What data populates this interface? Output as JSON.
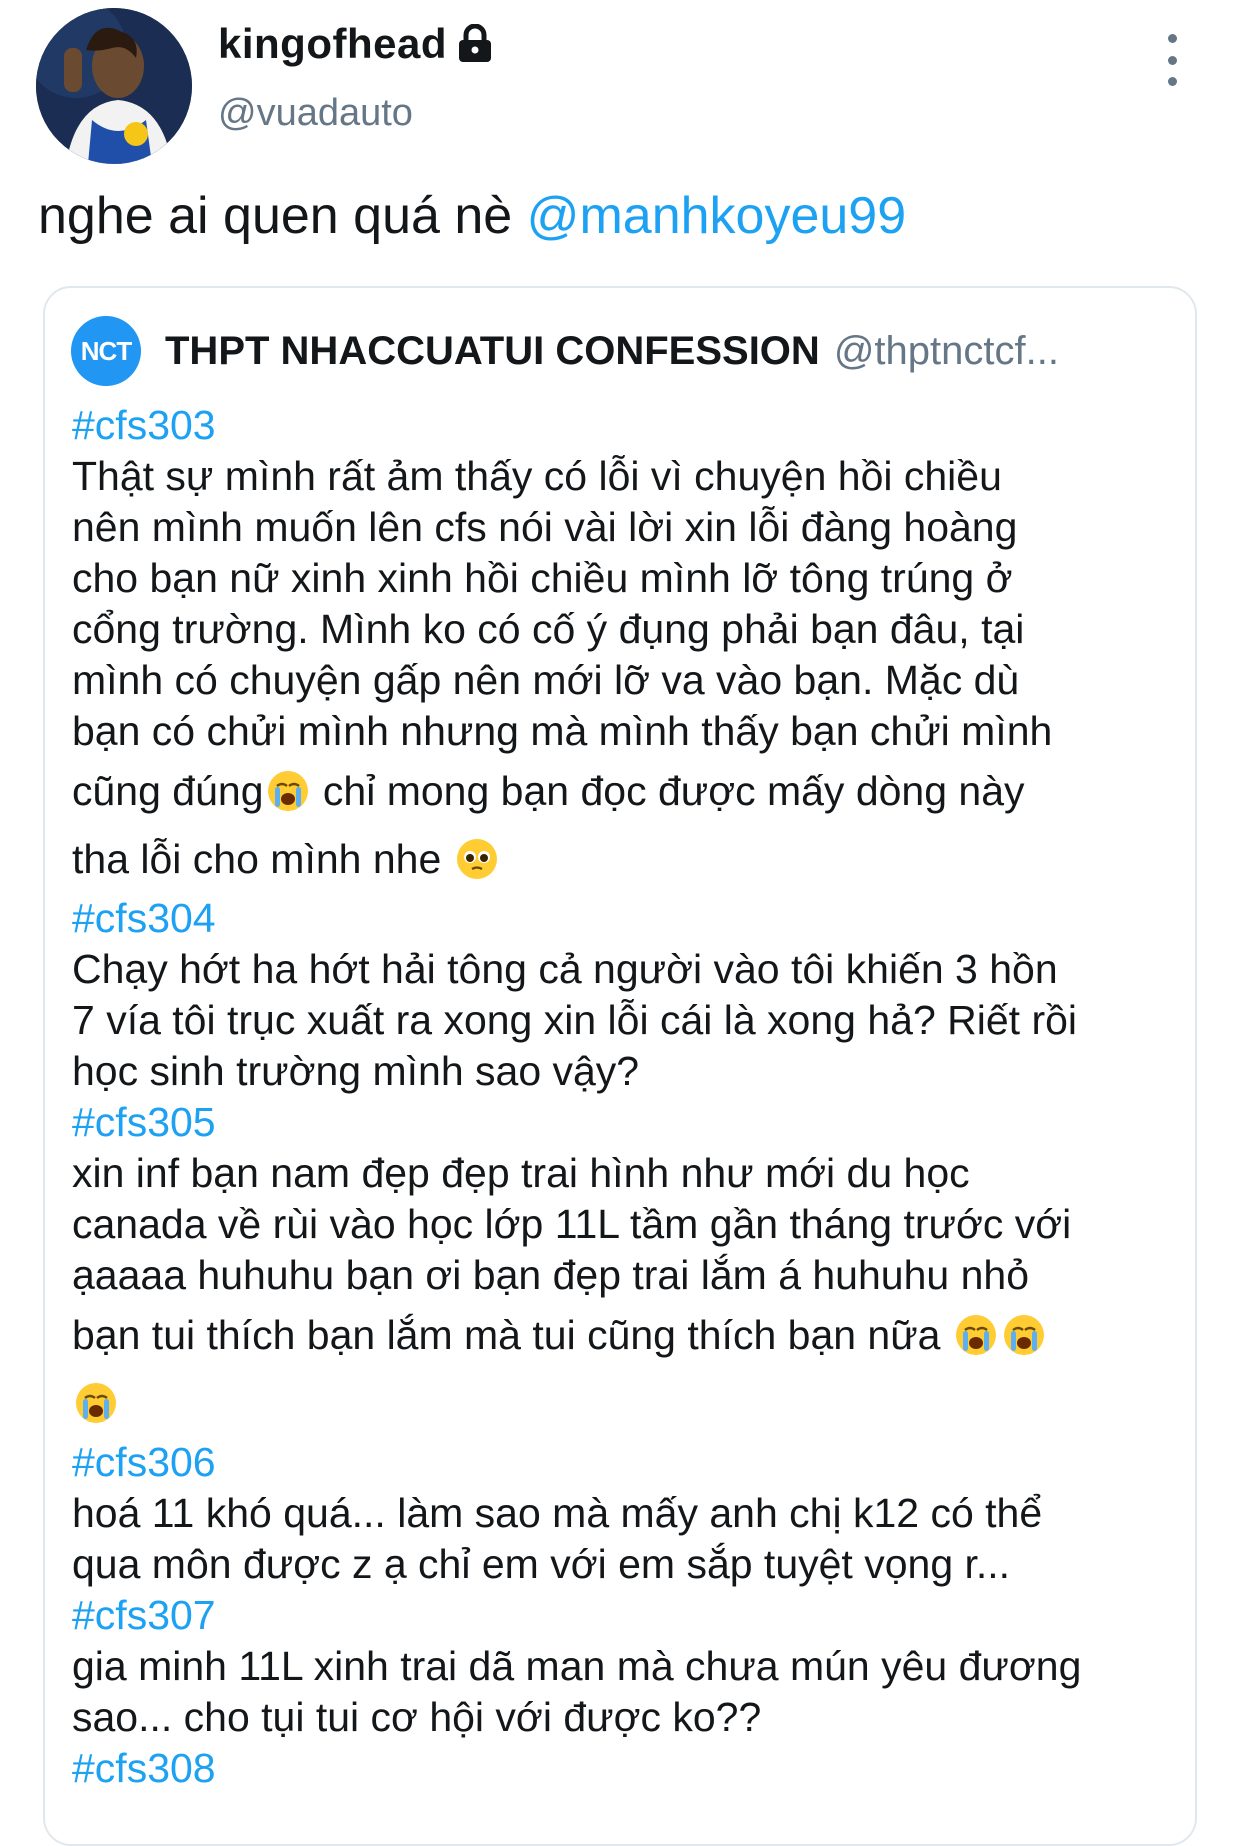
{
  "profile": {
    "display_name": "kingofhead",
    "handle": "@vuadauto",
    "avatar": "avatar-basketball-player",
    "lock_icon": "lock-icon"
  },
  "tweet": {
    "text": "nghe ai quen quá nè ",
    "mention": "@manhkoyeu99"
  },
  "quoted": {
    "logo_text": "NCT",
    "name": "THPT NHACCUATUI CONFESSION",
    "handle": "@thptnctcf...",
    "lines": [
      {
        "tag": "#cfs303"
      },
      {
        "text": "Thật sự mình rất ảm thấy có lỗi vì chuyện hồi chiều"
      },
      {
        "text": "nên mình muốn lên cfs nói vài lời xin lỗi đàng hoàng"
      },
      {
        "text": "cho bạn nữ xinh xinh hồi chiều mình lỡ tông trúng ở"
      },
      {
        "text": "cổng trường. Mình ko có cố ý đụng phải bạn đâu, tại"
      },
      {
        "text": "mình có chuyện gấp nên mới lỡ va vào bạn. Mặc dù"
      },
      {
        "text": "bạn có chửi mình nhưng mà mình thấy bạn chửi mình"
      },
      {
        "text": "cũng đúng",
        "emoji_after": "crying-face-emoji",
        "text2": " chỉ mong bạn đọc được mấy dòng này"
      },
      {
        "text": "tha lỗi cho mình nhe ",
        "emoji_after": "pleading-face-emoji"
      },
      {
        "tag": "#cfs304"
      },
      {
        "text": "Chạy hớt ha hớt hải tông cả người vào tôi khiến 3 hồn"
      },
      {
        "text": "7 vía tôi trục xuất ra xong xin lỗi cái là xong hả? Riết rồi"
      },
      {
        "text": "học sinh trường mình sao vậy?"
      },
      {
        "tag": "#cfs305"
      },
      {
        "text": "xin inf bạn nam đẹp đẹp trai hình như mới du học"
      },
      {
        "text": "canada về rùi vào học lớp 11L tầm gần tháng trước với"
      },
      {
        "text": "ạaaaa huhuhu bạn ơi bạn đẹp trai lắm á huhuhu nhỏ"
      },
      {
        "text": "bạn tui thích bạn lắm mà tui cũng thích bạn nữa ",
        "emoji_after": "crying-face-emoji",
        "emoji_after2": "crying-face-emoji"
      },
      {
        "text": "",
        "emoji_after": "crying-face-emoji"
      },
      {
        "tag": "#cfs306"
      },
      {
        "text": "hoá 11 khó quá... làm sao mà mấy anh chị k12 có thể"
      },
      {
        "text": "qua môn được z ạ chỉ em với em sắp tuyệt vọng r..."
      },
      {
        "tag": "#cfs307"
      },
      {
        "text": "gia minh 11L xinh trai dã man mà chưa mún yêu đương"
      },
      {
        "text": "sao... cho tụi tui cơ hội với được ko??"
      },
      {
        "tag": "#cfs308"
      }
    ]
  },
  "colors": {
    "link": "#1da1f2",
    "secondary": "#657786",
    "text": "#14171a",
    "border": "#e1e8ed",
    "nct_logo": "#2196f3"
  }
}
